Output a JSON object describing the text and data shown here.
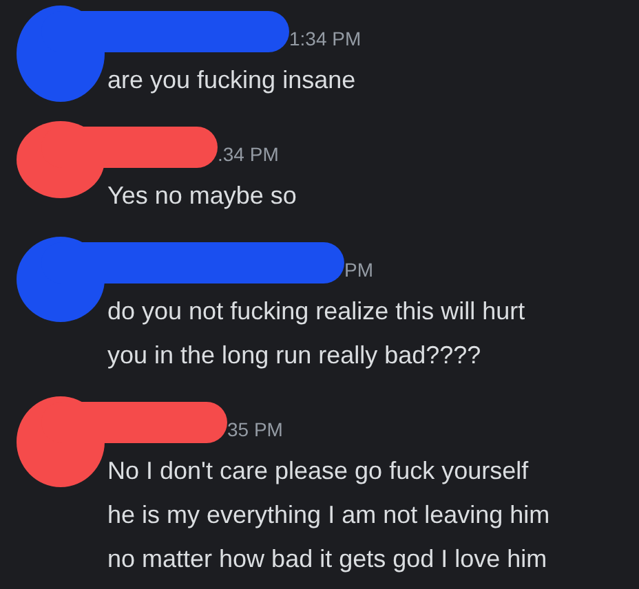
{
  "messages": [
    {
      "color": "#1a4ff0",
      "timestamp": "1:34 PM",
      "lines": [
        "are you fucking insane"
      ]
    },
    {
      "color": "#f54b4b",
      "timestamp": ".34 PM",
      "lines": [
        "Yes no maybe so"
      ]
    },
    {
      "color": "#1a4ff0",
      "timestamp": "PM",
      "lines": [
        "do you not fucking realize this will hurt",
        "you in the long run really bad????"
      ]
    },
    {
      "color": "#f54b4b",
      "timestamp": "35 PM",
      "lines": [
        "No I don't care please go fuck yourself",
        "he is my everything I am not leaving him",
        "no matter how bad it gets god I love him"
      ]
    }
  ]
}
